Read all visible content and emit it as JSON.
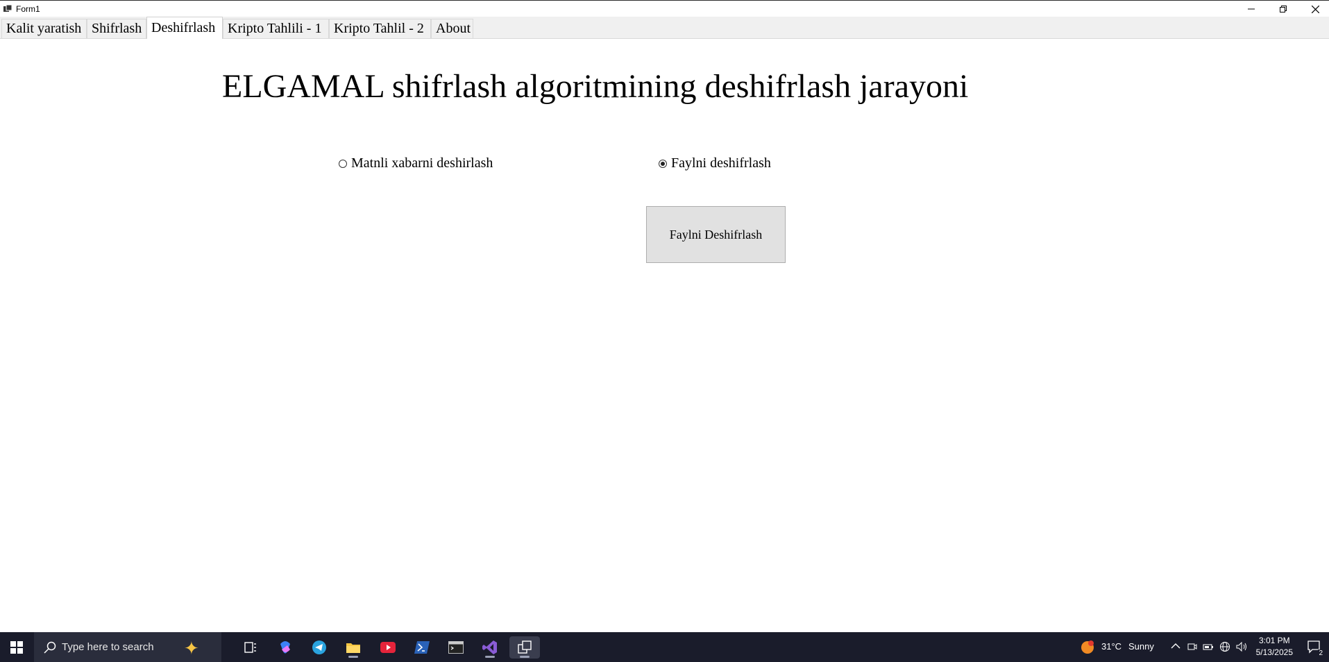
{
  "window": {
    "title": "Form1"
  },
  "tabs": [
    {
      "label": "Kalit yaratish"
    },
    {
      "label": "Shifrlash"
    },
    {
      "label": "Deshifrlash"
    },
    {
      "label": "Kripto Tahlili - 1"
    },
    {
      "label": "Kripto Tahlil - 2"
    },
    {
      "label": "About"
    }
  ],
  "main": {
    "heading": "ELGAMAL shifrlash algoritmining deshifrlash jarayoni",
    "radio_text": {
      "label": "Matnli xabarni deshirlash",
      "checked": false
    },
    "radio_file": {
      "label": "Faylni deshifrlash",
      "checked": true
    },
    "action_button": "Faylni Deshifrlash"
  },
  "taskbar": {
    "search_placeholder": "Type here to search",
    "weather": {
      "temp": "31°C",
      "condition": "Sunny"
    },
    "time": "3:01 PM",
    "date": "5/13/2025",
    "notification_count": "2"
  }
}
